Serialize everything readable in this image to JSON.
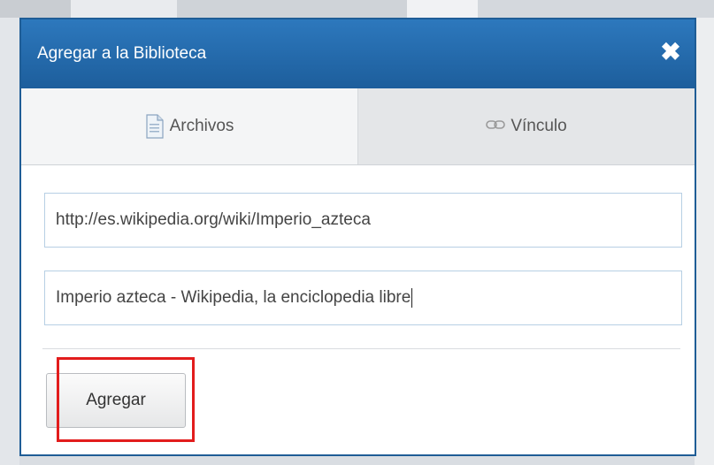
{
  "dialog": {
    "title": "Agregar a la Biblioteca",
    "close_icon": "close-icon"
  },
  "tabs": [
    {
      "label": "Archivos",
      "icon": "document-icon",
      "active": true
    },
    {
      "label": "Vínculo",
      "icon": "link-icon",
      "active": false
    }
  ],
  "form": {
    "url_value": "http://es.wikipedia.org/wiki/Imperio_azteca",
    "title_value": "Imperio azteca - Wikipedia, la enciclopedia libre"
  },
  "actions": {
    "add_label": "Agregar"
  },
  "colors": {
    "titlebar": "#1d5e9c",
    "highlight": "#e21c1c",
    "field_border": "#b7cfe4"
  }
}
